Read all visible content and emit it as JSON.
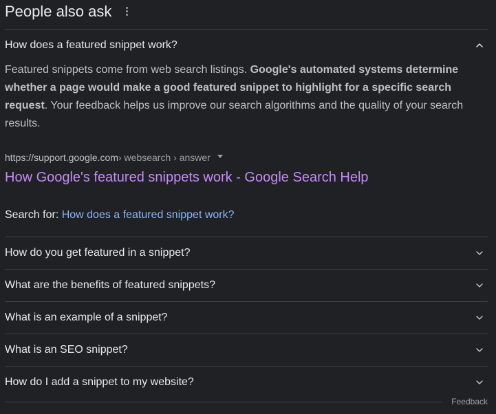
{
  "header": {
    "title": "People also ask",
    "menu_icon": "more-vert-icon"
  },
  "expanded": {
    "question": "How does a featured snippet work?",
    "answer": {
      "text_1": "Featured snippets come from web search listings. ",
      "bold": "Google's automated systems determine whether a page would make a good featured snippet to highlight for a specific search request",
      "text_2": ". Your feedback helps us improve our search algorithms and the quality of your search results."
    },
    "source": {
      "domain": "https://support.google.com",
      "path": " › websearch › answer"
    },
    "result_title": "How Google's featured snippets work - Google Search Help",
    "search_for_label": "Search for: ",
    "search_for_query": "How does a featured snippet work?"
  },
  "questions": [
    "How do you get featured in a snippet?",
    "What are the benefits of featured snippets?",
    "What is an example of a snippet?",
    "What is an SEO snippet?",
    "How do I add a snippet to my website?"
  ],
  "footer": {
    "feedback": "Feedback"
  },
  "colors": {
    "background": "#202124",
    "text": "#e8eaed",
    "muted": "#bdc1c6",
    "visited_link": "#c58af9",
    "link": "#8ab4f8",
    "divider": "#3c4043"
  }
}
